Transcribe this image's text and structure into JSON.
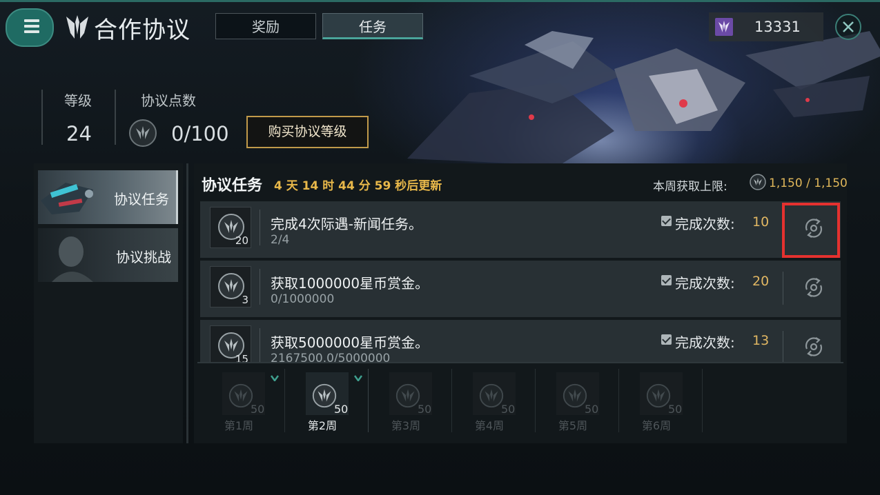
{
  "header": {
    "title": "合作协议",
    "tabs": [
      {
        "label": "奖励",
        "active": false
      },
      {
        "label": "任务",
        "active": true
      }
    ],
    "currency_value": "13331"
  },
  "level_info": {
    "level_label": "等级",
    "level_value": "24",
    "points_label": "协议点数",
    "points_value": "0/100",
    "buy_button": "购买协议等级"
  },
  "sidebar": {
    "items": [
      {
        "label": "协议任务",
        "selected": true
      },
      {
        "label": "协议挑战",
        "selected": false
      }
    ]
  },
  "tasks_section": {
    "title": "协议任务",
    "timer": "4 天 14 时 44 分 59 秒后更新",
    "weekly_limit_label": "本周获取上限:",
    "weekly_limit_value": "1,150 / 1,150",
    "done_label": "完成次数:",
    "tasks": [
      {
        "reward": "20",
        "title": "完成4次际遇-新闻任务。",
        "progress": "2/4",
        "completions": "10"
      },
      {
        "reward": "3",
        "title": "获取1000000星币赏金。",
        "progress": "0/1000000",
        "completions": "20"
      },
      {
        "reward": "15",
        "title": "获取5000000星币赏金。",
        "progress": "2167500.0/5000000",
        "completions": "13"
      }
    ]
  },
  "weeks": [
    {
      "label": "第1周",
      "value": "50",
      "claimed": true,
      "current": false
    },
    {
      "label": "第2周",
      "value": "50",
      "claimed": true,
      "current": true
    },
    {
      "label": "第3周",
      "value": "50",
      "claimed": false,
      "current": false
    },
    {
      "label": "第4周",
      "value": "50",
      "claimed": false,
      "current": false
    },
    {
      "label": "第5周",
      "value": "50",
      "claimed": false,
      "current": false
    },
    {
      "label": "第6周",
      "value": "50",
      "claimed": false,
      "current": false
    }
  ],
  "colors": {
    "accent": "#1f6b63",
    "gold": "#e1b763",
    "highlight": "#e5312f",
    "currency": "#6b4aa6"
  }
}
